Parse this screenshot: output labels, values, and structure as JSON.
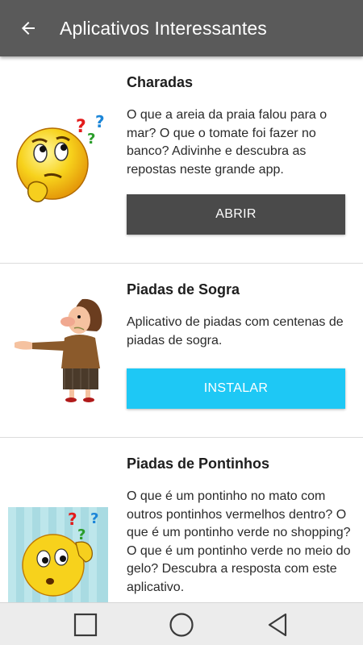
{
  "appbar": {
    "title": "Aplicativos Interessantes",
    "back_icon": "arrow-left-icon"
  },
  "apps": [
    {
      "title": "Charadas",
      "description": "O que a areia da praia falou para o mar? O que o tomate foi fazer no banco? Adivinhe e descubra as repostas neste grande app.",
      "button_label": "ABRIR",
      "button_color": "#4a4a4a",
      "icon": "thinking-emoji-icon"
    },
    {
      "title": "Piadas de Sogra",
      "description": "Aplicativo de piadas com centenas de piadas de sogra.",
      "button_label": "INSTALAR",
      "button_color": "#1ec8f5",
      "icon": "mother-in-law-cartoon-icon"
    },
    {
      "title": "Piadas de Pontinhos",
      "description": "O que é um pontinho no mato com outros pontinhos vermelhos dentro? O que é um pontinho verde no shopping? O que é um pontinho verde no meio do gelo? Descubra a resposta com este aplicativo.",
      "icon": "confused-emoji-icon"
    }
  ],
  "navbar": {
    "recents_icon": "square-icon",
    "home_icon": "circle-icon",
    "back_icon": "triangle-back-icon"
  },
  "colors": {
    "appbar": "#5a5a5a",
    "navbar": "#ececec",
    "divider": "#dcdcdc"
  }
}
